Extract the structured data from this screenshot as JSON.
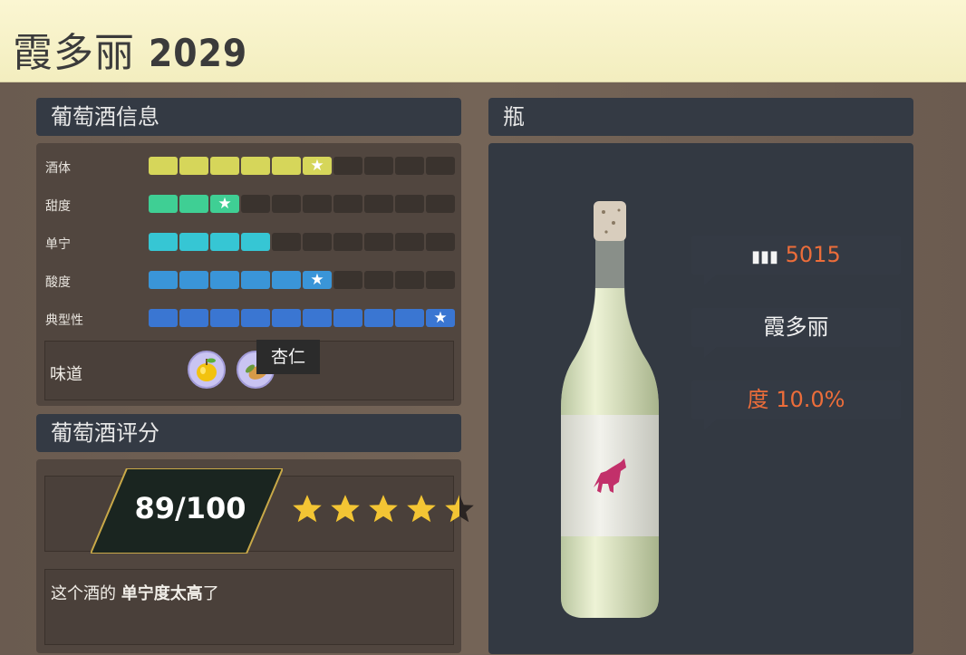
{
  "title": {
    "name": "霞多丽",
    "year": "2029"
  },
  "info_panel": {
    "header": "葡萄酒信息",
    "rows": [
      {
        "label": "酒体",
        "filled": 6,
        "star": 6,
        "color": "#d6d65a"
      },
      {
        "label": "甜度",
        "filled": 3,
        "star": 3,
        "color": "#3fcf94"
      },
      {
        "label": "单宁",
        "filled": 4,
        "star": 0,
        "color": "#36c6d4"
      },
      {
        "label": "酸度",
        "filled": 6,
        "star": 6,
        "color": "#3a95d8"
      },
      {
        "label": "典型性",
        "filled": 10,
        "star": 10,
        "color": "#3a76d2"
      }
    ],
    "total_segments": 10,
    "flavor_label": "味道",
    "flavors": [
      "apple-icon",
      "almond-icon"
    ],
    "tooltip": "杏仁"
  },
  "rating_panel": {
    "header": "葡萄酒评分",
    "score": "89/100",
    "stars": 4.5,
    "review_prefix": "这个酒的 ",
    "review_bold": "单宁度太高",
    "review_suffix": "了"
  },
  "bottle_panel": {
    "header": "瓶",
    "count": "5015",
    "count_icon": "bottles-icon",
    "varietal": "霞多丽",
    "abv_prefix": "度",
    "abv": "10.0%",
    "accent_color": "#ec6d3a"
  }
}
